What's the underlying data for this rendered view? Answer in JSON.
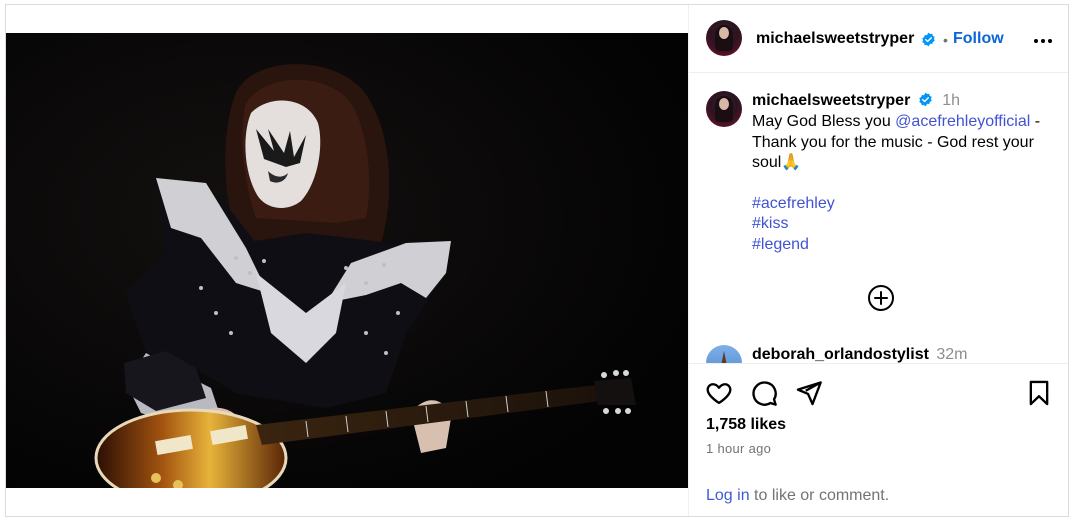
{
  "post": {
    "author": "michaelsweetstryper",
    "follow_label": "Follow",
    "separator": "•",
    "more_label": "More options"
  },
  "caption": {
    "author": "michaelsweetstryper",
    "time": "1h",
    "text_before": "May God Bless you ",
    "mention": "@acefrehleyofficial",
    "text_after": " - Thank you for the music - God rest your soul🙏",
    "hashtags": [
      "#acefrehley",
      "#kiss",
      "#legend"
    ]
  },
  "comment_preview": {
    "author": "deborah_orlandostylist",
    "time": "32m"
  },
  "engagement": {
    "likes": "1,758 likes",
    "posted_ago": "1 hour ago",
    "login_link": "Log in",
    "login_suffix": " to like or comment."
  },
  "icons": {
    "like": "heart-icon",
    "comment": "comment-icon",
    "share": "send-icon",
    "save": "bookmark-icon",
    "load_more": "plus-circle-icon",
    "verified": "verified-badge-icon",
    "more": "more-horizontal-icon"
  },
  "colors": {
    "link": "#4152d3",
    "verified": "#0095f6",
    "muted": "#737373",
    "border": "#dbdbdb"
  }
}
